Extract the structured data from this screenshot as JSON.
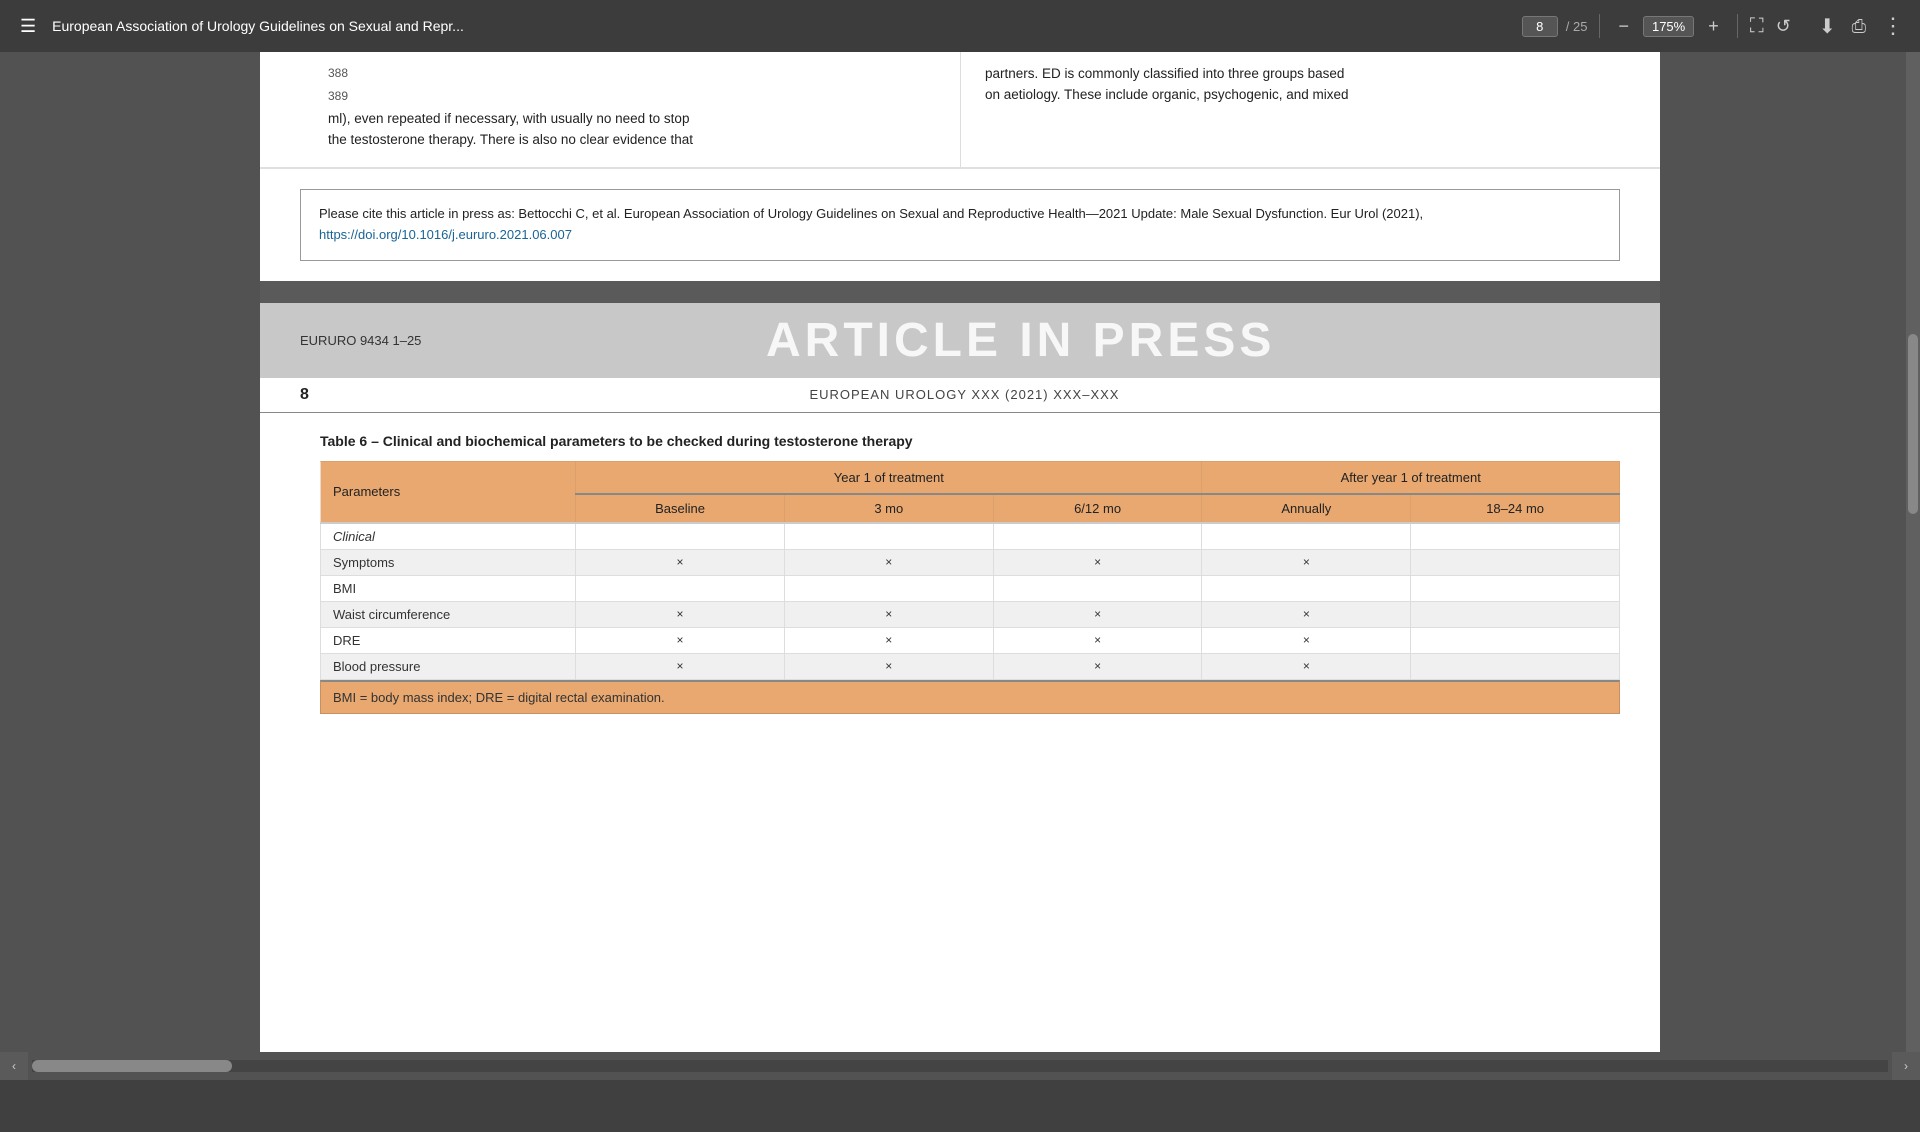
{
  "toolbar": {
    "menu_icon": "☰",
    "title": "European Association of Urology Guidelines on Sexual and Repr...",
    "current_page": "8",
    "total_pages": "25",
    "zoom": "175%",
    "zoom_minus": "−",
    "zoom_plus": "+",
    "download_icon": "⬇",
    "print_icon": "⎙",
    "more_icon": "⋮",
    "fit_icon": "⛶",
    "rotate_icon": "↺"
  },
  "page": {
    "left_text_line1": "ml), even repeated if necessary, with usually no need to stop",
    "left_text_line2": "the testosterone therapy. There is also no clear evidence that",
    "right_text_line1": "partners. ED is commonly classified into three groups based",
    "right_text_line2": "on aetiology. These include organic, psychogenic, and mixed",
    "line_numbers": [
      "388",
      "389"
    ],
    "citation": {
      "text": "Please cite this article in press as: Bettocchi C, et al. European Association of Urology Guidelines on Sexual and Reproductive Health—2021 Update: Male Sexual Dysfunction. Eur Urol (2021), ",
      "link_text": "https://doi.org/10.1016/j.eururo.2021.06.007",
      "link_url": "https://doi.org/10.1016/j.eururo.2021.06.007"
    },
    "article_header": {
      "eururo": "EURURO 9434 1–25",
      "article_in_press": "ARTICLE IN PRESS"
    },
    "journal_header": {
      "page_num": "8",
      "journal_name": "EUROPEAN UROLOGY XXX (2021) XXX–XXX"
    },
    "table": {
      "caption": "Table 6 – Clinical and biochemical parameters to be checked during testosterone therapy",
      "col_headers_row1": {
        "parameters": "Parameters",
        "year1": "Year 1 of treatment",
        "after_year1": "After year 1 of treatment"
      },
      "col_headers_row2": {
        "baseline": "Baseline",
        "three_mo": "3 mo",
        "six_mo": "6/12 mo",
        "annually": "Annually",
        "eighteen_mo": "18–24 mo"
      },
      "rows": [
        {
          "type": "clinical-label",
          "parameter": "Clinical",
          "baseline": "",
          "three_mo": "",
          "six_mo": "",
          "annually": "",
          "eighteen_mo": ""
        },
        {
          "type": "odd",
          "parameter": "Symptoms",
          "baseline": "×",
          "three_mo": "×",
          "six_mo": "×",
          "annually": "×",
          "eighteen_mo": ""
        },
        {
          "type": "even",
          "parameter": "BMI",
          "baseline": "",
          "three_mo": "",
          "six_mo": "",
          "annually": "",
          "eighteen_mo": ""
        },
        {
          "type": "odd",
          "parameter": "Waist circumference",
          "baseline": "×",
          "three_mo": "×",
          "six_mo": "×",
          "annually": "×",
          "eighteen_mo": ""
        },
        {
          "type": "even",
          "parameter": "DRE",
          "baseline": "×",
          "three_mo": "×",
          "six_mo": "×",
          "annually": "×",
          "eighteen_mo": ""
        },
        {
          "type": "odd",
          "parameter": "Blood pressure",
          "baseline": "×",
          "three_mo": "×",
          "six_mo": "×",
          "annually": "×",
          "eighteen_mo": ""
        }
      ],
      "footer_note": "BMI = body mass index; DRE = digital rectal examination."
    }
  }
}
